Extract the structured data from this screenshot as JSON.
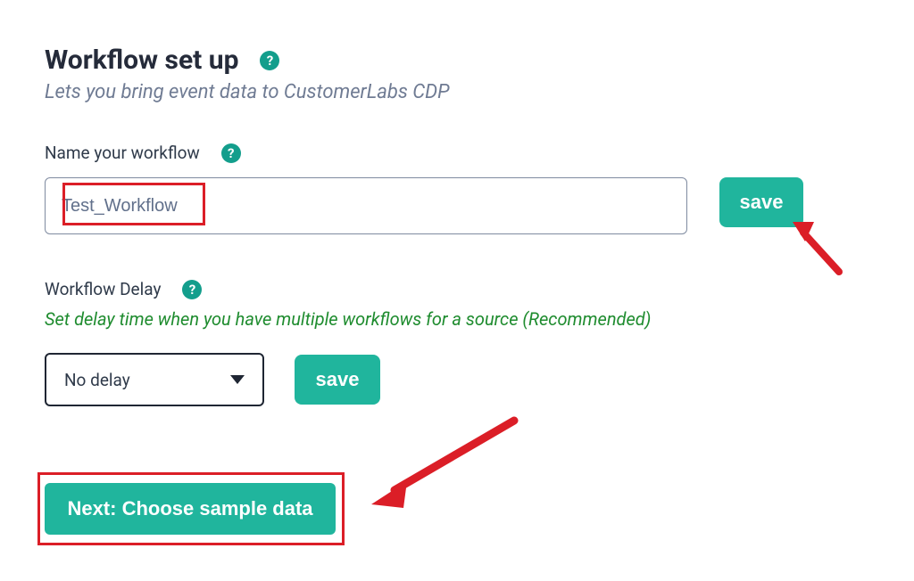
{
  "header": {
    "title": "Workflow set up",
    "subtitle": "Lets you bring event data to CustomerLabs CDP"
  },
  "help_glyph": "?",
  "name_section": {
    "label": "Name your workflow",
    "input_value": "Test_Workflow",
    "save_label": "save"
  },
  "delay_section": {
    "label": "Workflow Delay",
    "hint": "Set delay time when you have multiple workflows for a source (Recommended)",
    "selected": "No delay",
    "save_label": "save"
  },
  "footer": {
    "next_label": "Next: Choose sample data"
  },
  "colors": {
    "accent": "#20b59d",
    "highlight": "#db1e27"
  }
}
